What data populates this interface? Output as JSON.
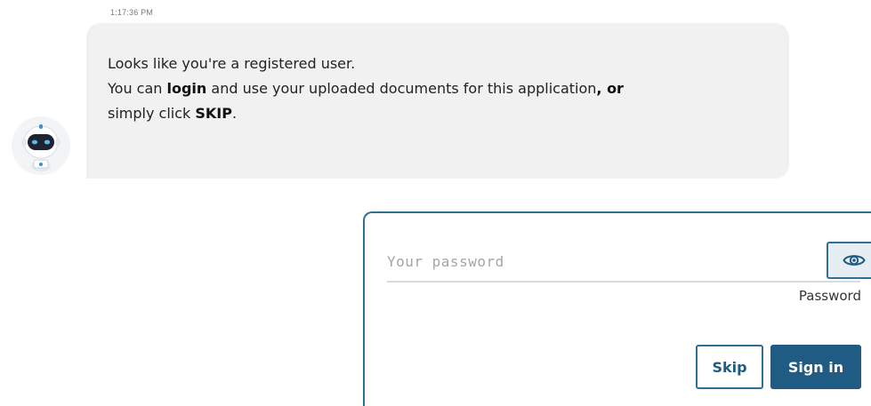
{
  "message": {
    "timestamp": "1:17:36 PM",
    "line1": "Looks like you're a registered user.",
    "line2_prefix": "You can ",
    "line2_bold_login": "login",
    "line2_middle": " and use your uploaded documents for this application",
    "line2_comma": ", ",
    "line2_bold_or": "or",
    "line3_prefix": "simply click ",
    "line3_bold_skip": "SKIP",
    "line3_suffix": ".",
    "avatar_icon": "robot-icon"
  },
  "login_form": {
    "password_placeholder": "Your password",
    "password_value": "",
    "toggle_icon": "eye-icon",
    "password_label": "Password",
    "skip_label": "Skip",
    "signin_label": "Sign in"
  },
  "colors": {
    "accent": "#1f5b82",
    "border": "#2f6f93",
    "bubble_bg": "#f1f1f1"
  }
}
